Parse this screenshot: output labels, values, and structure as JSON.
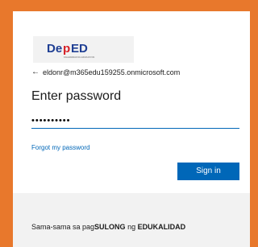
{
  "logo": {
    "text": "DepED",
    "tagline": "KAGAWARAN NG EDUKASYON"
  },
  "account": {
    "back_icon": "back-arrow-icon",
    "email": "eldonr@m365edu159255.onmicrosoft.com"
  },
  "page": {
    "title": "Enter password"
  },
  "password": {
    "value": "Deped12345"
  },
  "links": {
    "forgot_password": "Forgot my password"
  },
  "actions": {
    "sign_in": "Sign in"
  },
  "footer": {
    "part1": "Sama-sama sa pag",
    "part2": "SULONG",
    "part3": " ng ",
    "part4": "EDUKALIDAD"
  },
  "colors": {
    "background": "#e8782c",
    "accent": "#0067b8",
    "logo_red": "#d62027",
    "logo_blue": "#1f3f94"
  }
}
